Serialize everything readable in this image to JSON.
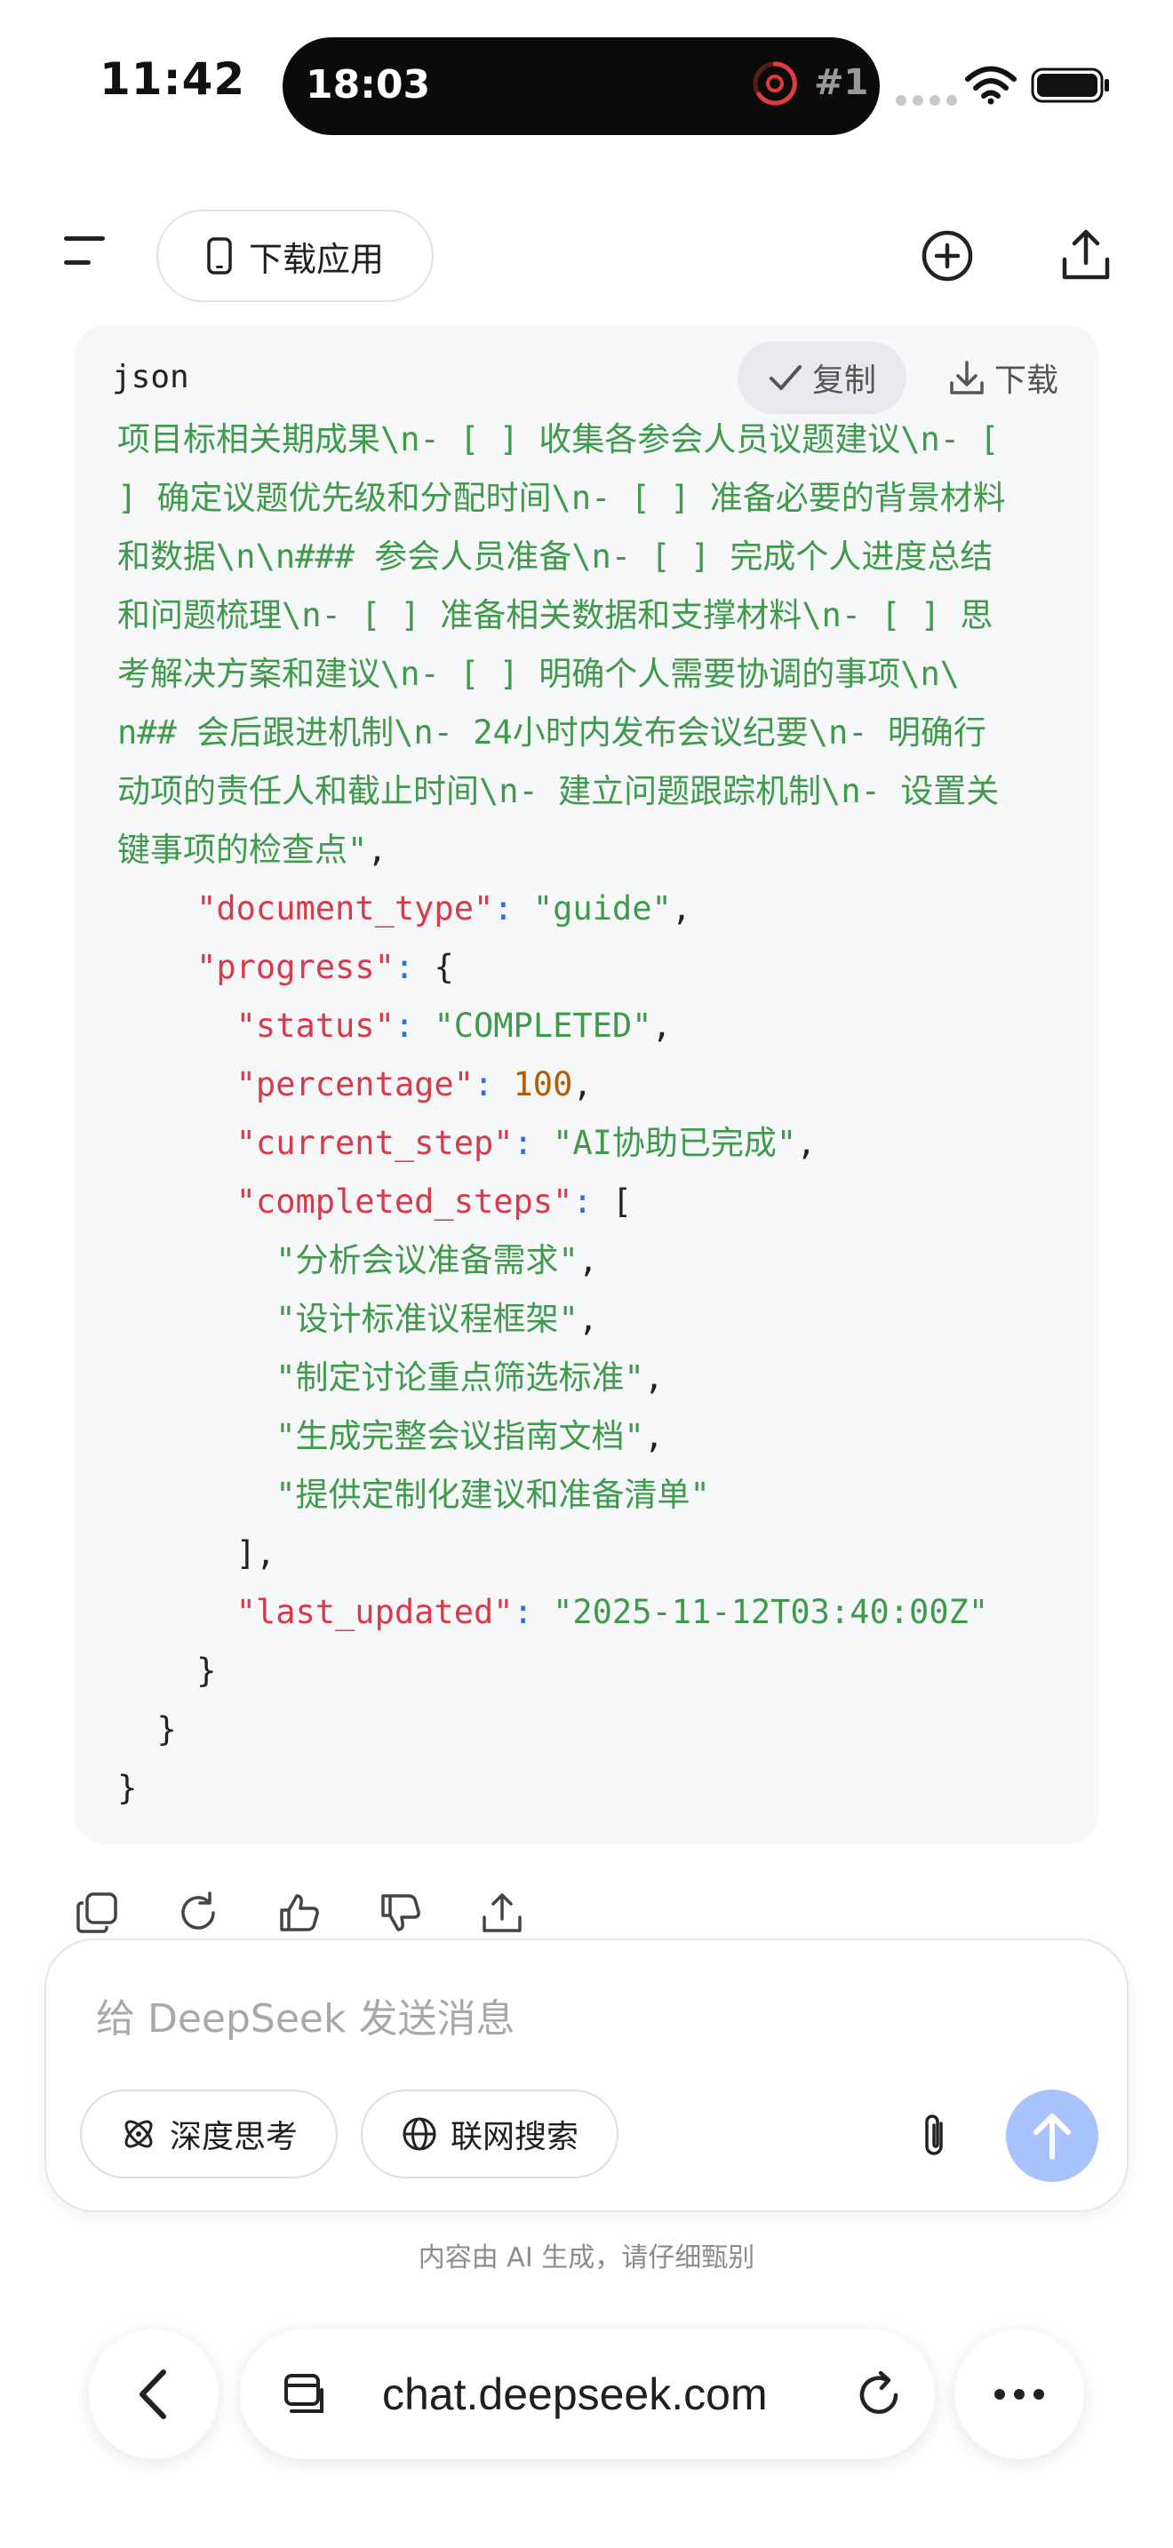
{
  "status_bar": {
    "time": "11:42",
    "island_time": "18:03",
    "island_badge": "#1"
  },
  "top_bar": {
    "download_app_label": "下载应用",
    "icons": [
      "menu-icon",
      "new-chat-icon",
      "share-icon"
    ]
  },
  "code_block": {
    "language": "json",
    "copy_label": "复制",
    "download_label": "下载",
    "lines": [
      [
        [
          "str",
          "项目标相关期成果\\n- [ ] 收集各参会人员议题建议\\n- ["
        ]
      ],
      [
        [
          "str",
          "] 确定议题优先级和分配时间\\n- [ ] 准备必要的背景材料"
        ]
      ],
      [
        [
          "str",
          "和数据\\n\\n### 参会人员准备\\n- [ ] 完成个人进度总结"
        ]
      ],
      [
        [
          "str",
          "和问题梳理\\n- [ ] 准备相关数据和支撑材料\\n- [ ] 思"
        ]
      ],
      [
        [
          "str",
          "考解决方案和建议\\n- [ ] 明确个人需要协调的事项\\n\\"
        ]
      ],
      [
        [
          "str",
          "n## 会后跟进机制\\n- 24小时内发布会议纪要\\n- 明确行"
        ]
      ],
      [
        [
          "str",
          "动项的责任人和截止时间\\n- 建立问题跟踪机制\\n- 设置关"
        ]
      ],
      [
        [
          "str",
          "键事项的检查点\""
        ],
        [
          "pun",
          ","
        ]
      ],
      [
        [
          "pun",
          "    "
        ],
        [
          "key",
          "\"document_type\""
        ],
        [
          "col",
          ": "
        ],
        [
          "str",
          "\"guide\""
        ],
        [
          "pun",
          ","
        ]
      ],
      [
        [
          "pun",
          "    "
        ],
        [
          "key",
          "\"progress\""
        ],
        [
          "col",
          ": "
        ],
        [
          "pun",
          "{"
        ]
      ],
      [
        [
          "pun",
          "      "
        ],
        [
          "key",
          "\"status\""
        ],
        [
          "col",
          ": "
        ],
        [
          "str",
          "\"COMPLETED\""
        ],
        [
          "pun",
          ","
        ]
      ],
      [
        [
          "pun",
          "      "
        ],
        [
          "key",
          "\"percentage\""
        ],
        [
          "col",
          ": "
        ],
        [
          "num",
          "100"
        ],
        [
          "pun",
          ","
        ]
      ],
      [
        [
          "pun",
          "      "
        ],
        [
          "key",
          "\"current_step\""
        ],
        [
          "col",
          ": "
        ],
        [
          "str",
          "\"AI协助已完成\""
        ],
        [
          "pun",
          ","
        ]
      ],
      [
        [
          "pun",
          "      "
        ],
        [
          "key",
          "\"completed_steps\""
        ],
        [
          "col",
          ": "
        ],
        [
          "pun",
          "["
        ]
      ],
      [
        [
          "pun",
          "        "
        ],
        [
          "str",
          "\"分析会议准备需求\""
        ],
        [
          "pun",
          ","
        ]
      ],
      [
        [
          "pun",
          "        "
        ],
        [
          "str",
          "\"设计标准议程框架\""
        ],
        [
          "pun",
          ","
        ]
      ],
      [
        [
          "pun",
          "        "
        ],
        [
          "str",
          "\"制定讨论重点筛选标准\""
        ],
        [
          "pun",
          ","
        ]
      ],
      [
        [
          "pun",
          "        "
        ],
        [
          "str",
          "\"生成完整会议指南文档\""
        ],
        [
          "pun",
          ","
        ]
      ],
      [
        [
          "pun",
          "        "
        ],
        [
          "str",
          "\"提供定制化建议和准备清单\""
        ]
      ],
      [
        [
          "pun",
          "      ],"
        ]
      ],
      [
        [
          "pun",
          "      "
        ],
        [
          "key",
          "\"last_updated\""
        ],
        [
          "col",
          ": "
        ],
        [
          "str",
          "\"2025-11-12T03:40:00Z\""
        ]
      ],
      [
        [
          "pun",
          "    }"
        ]
      ],
      [
        [
          "pun",
          "  }"
        ]
      ],
      [
        [
          "pun",
          "}"
        ]
      ]
    ]
  },
  "message_actions": [
    "copy-icon",
    "regenerate-icon",
    "thumbs-up-icon",
    "thumbs-down-icon",
    "share-icon"
  ],
  "composer": {
    "placeholder": "给 DeepSeek 发送消息",
    "deep_think_label": "深度思考",
    "web_search_label": "联网搜索"
  },
  "disclaimer": "内容由 AI 生成，请仔细甄别",
  "browser": {
    "url": "chat.deepseek.com"
  },
  "colors": {
    "json_key": "#d73a49",
    "json_string": "#3f9a4b",
    "json_number": "#b35c00",
    "send_button": "#a9c3ff"
  }
}
